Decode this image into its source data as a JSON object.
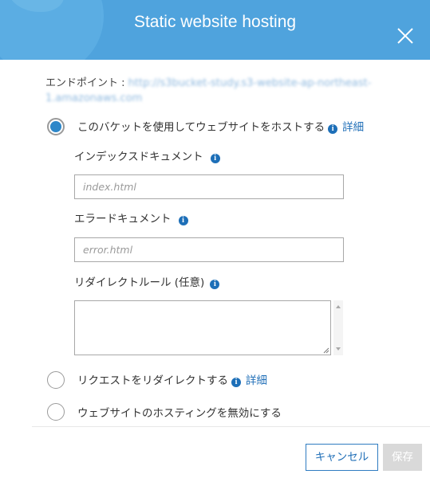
{
  "dialog": {
    "title": "Static website hosting",
    "close_icon": "close-icon"
  },
  "endpoint": {
    "label": "エンドポイント :",
    "value_line1": "http://s3bucket-study.s3-website-ap-northeast-",
    "value_line2": "1.amazonaws.com"
  },
  "options": {
    "host": {
      "label": "このバケットを使用してウェブサイトをホストする",
      "info_icon": "info-icon",
      "link": "詳細",
      "selected": true
    },
    "redirect": {
      "label": "リクエストをリダイレクトする",
      "info_icon": "info-icon",
      "link": "詳細",
      "selected": false
    },
    "disable": {
      "label": "ウェブサイトのホスティングを無効にする",
      "selected": false
    }
  },
  "fields": {
    "index_document": {
      "label": "インデックスドキュメント",
      "placeholder": "index.html"
    },
    "error_document": {
      "label": "エラードキュメント",
      "placeholder": "error.html"
    },
    "redirect_rules": {
      "label": "リダイレクトルール (任意)",
      "value": ""
    }
  },
  "footer": {
    "cancel_label": "キャンセル",
    "save_label": "保存"
  },
  "colors": {
    "header": "#4fa3dd",
    "accent": "#2270b8",
    "radio_selected": "#2d87c9",
    "disabled_button": "#d9d9d9"
  }
}
